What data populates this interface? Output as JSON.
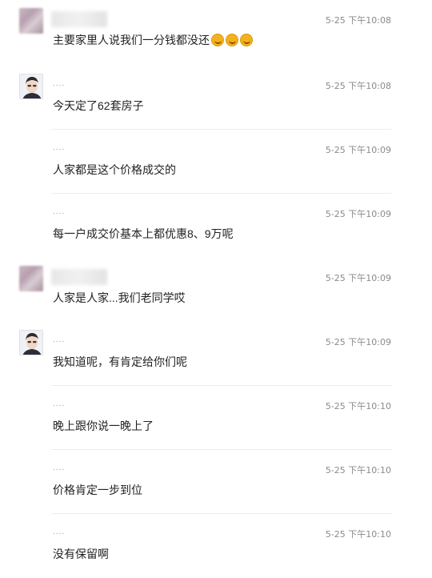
{
  "messages": [
    {
      "name": "",
      "avatar": "blurred",
      "time": "5-25 下午10:08",
      "text": "主要家里人说我们一分钱都没还",
      "emoji": [
        "laugh-cry-icon",
        "laugh-cry-icon",
        "laugh-cry-icon"
      ],
      "divider": false
    },
    {
      "name": "....",
      "avatar": "photo",
      "time": "5-25 下午10:08",
      "text": "今天定了62套房子",
      "divider": true
    },
    {
      "name": "....",
      "avatar": "",
      "time": "5-25 下午10:09",
      "text": "人家都是这个价格成交的",
      "divider": true
    },
    {
      "name": "....",
      "avatar": "",
      "time": "5-25 下午10:09",
      "text": "每一户成交价基本上都优惠8、9万呢",
      "divider": false
    },
    {
      "name": "",
      "avatar": "blurred",
      "time": "5-25 下午10:09",
      "text": "人家是人家...我们老同学哎",
      "divider": false
    },
    {
      "name": "....",
      "avatar": "photo",
      "time": "5-25 下午10:09",
      "text": "我知道呢，有肯定给你们呢",
      "divider": true
    },
    {
      "name": "....",
      "avatar": "",
      "time": "5-25 下午10:10",
      "text": "晚上跟你说一晚上了",
      "divider": true
    },
    {
      "name": "....",
      "avatar": "",
      "time": "5-25 下午10:10",
      "text": "价格肯定一步到位",
      "divider": true
    },
    {
      "name": "....",
      "avatar": "",
      "time": "5-25 下午10:10",
      "text": "没有保留啊",
      "divider": false
    }
  ]
}
